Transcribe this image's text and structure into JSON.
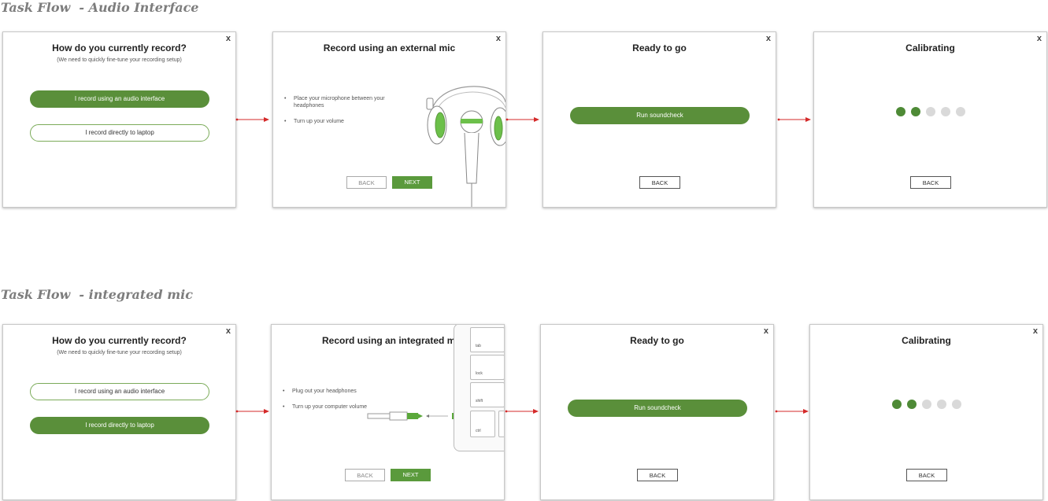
{
  "flows": [
    {
      "title": "Task Flow  - Audio Interface",
      "cards": [
        {
          "close": "x",
          "title": "How do you currently record?",
          "subtitle": "(We need to quickly fine-tune your recording setup)",
          "option_1": "I record using an audio interface",
          "option_2": "I record directly to laptop",
          "selected": "option_1"
        },
        {
          "close": "x",
          "title": "Record using an external mic",
          "bullets": [
            "Place your microphone between your headphones",
            "Turn up your volume"
          ],
          "back_label": "BACK",
          "next_label": "NEXT"
        },
        {
          "close": "x",
          "title": "Ready to go",
          "action_label": "Run soundcheck",
          "back_label": "BACK"
        },
        {
          "close": "x",
          "title": "Calibrating",
          "progress_dots": {
            "filled": 2,
            "total": 5
          },
          "back_label": "BACK"
        }
      ]
    },
    {
      "title": "Task Flow  - integrated mic",
      "cards": [
        {
          "close": "x",
          "title": "How do you currently record?",
          "subtitle": "(We need to quickly fine-tune your recording setup)",
          "option_1": "I record using an audio interface",
          "option_2": "I record directly to laptop",
          "selected": "option_2"
        },
        {
          "close": "x",
          "title": "Record using an integrated mic",
          "bullets": [
            "Plug out your headphones",
            "Turn up your computer volume"
          ],
          "keys": [
            "tab",
            "lock",
            "shift",
            "ctrl"
          ],
          "back_label": "BACK",
          "next_label": "NEXT"
        },
        {
          "close": "x",
          "title": "Ready to go",
          "action_label": "Run soundcheck",
          "back_label": "BACK"
        },
        {
          "close": "x",
          "title": "Calibrating",
          "progress_dots": {
            "filled": 2,
            "total": 5
          },
          "back_label": "BACK"
        }
      ]
    }
  ],
  "colors": {
    "accent_green": "#5a8f3a",
    "connector_red": "#d42a2a",
    "dot_inactive": "#d9d9d9"
  },
  "icons": [
    "headphones-mic-illustration",
    "headphone-jack-keyboard-illustration",
    "flow-arrow"
  ]
}
